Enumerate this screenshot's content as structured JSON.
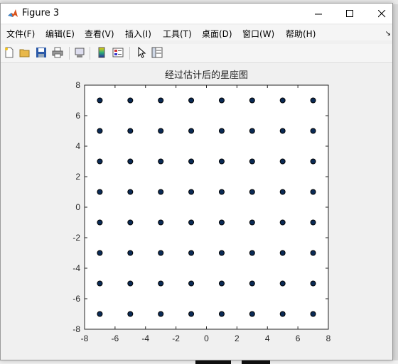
{
  "window": {
    "title": "Figure 3"
  },
  "menu": {
    "items": [
      "文件(F)",
      "编辑(E)",
      "查看(V)",
      "插入(I)",
      "工具(T)",
      "桌面(D)",
      "窗口(W)",
      "帮助(H)"
    ]
  },
  "toolbar": {
    "icons": [
      "new-figure-icon",
      "open-file-icon",
      "save-icon",
      "print-icon",
      "link-plot-icon",
      "colorbar-icon",
      "legend-icon",
      "pointer-icon",
      "property-inspector-icon"
    ]
  },
  "chart_data": {
    "type": "scatter",
    "title": "经过估计后的星座图",
    "xlabel": "",
    "ylabel": "",
    "xlim": [
      -8,
      8
    ],
    "ylim": [
      -8,
      8
    ],
    "xticks": [
      -8,
      -6,
      -4,
      -2,
      0,
      2,
      4,
      6,
      8
    ],
    "yticks": [
      -8,
      -6,
      -4,
      -2,
      0,
      2,
      4,
      6,
      8
    ],
    "grid": false,
    "marker_color": "#0a2a55",
    "marker_edge": "#000000",
    "points": {
      "x_levels": [
        -7,
        -5,
        -3,
        -1,
        1,
        3,
        5,
        7
      ],
      "y_levels": [
        -7,
        -5,
        -3,
        -1,
        1,
        3,
        5,
        7
      ]
    }
  }
}
